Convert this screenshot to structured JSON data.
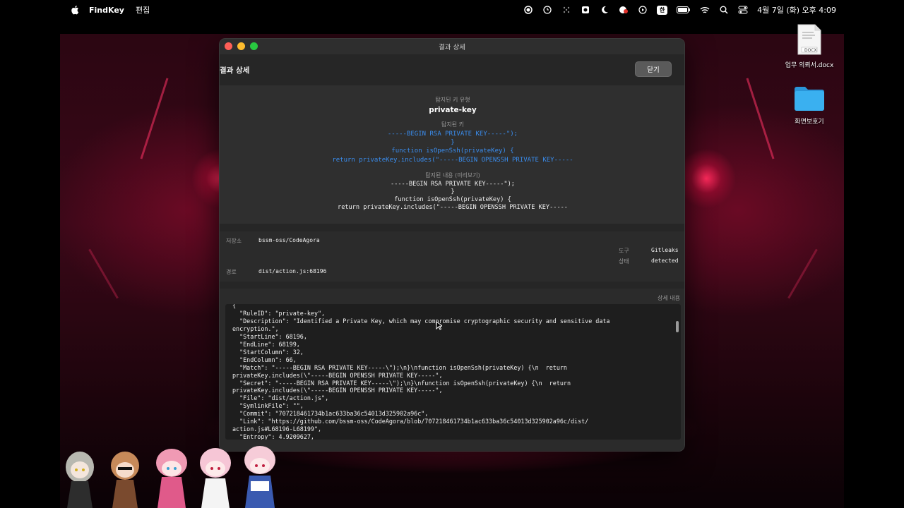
{
  "menubar": {
    "app_name": "FindKey",
    "menu_edit": "편집",
    "datetime": "4월 7일 (화) 오후 4:09",
    "input_source": "한"
  },
  "desktop": {
    "file_name": "업무 의뢰서.docx",
    "file_badge": "DOCX",
    "folder_name": "화면보호기"
  },
  "window": {
    "titlebar": "결과 상세",
    "header_title": "결과 상세",
    "close_label": "닫기",
    "key_type_label": "탐지된 키 유형",
    "key_type": "private-key",
    "detected_key_label": "탐지된 키",
    "detected_key_lines": [
      "-----BEGIN RSA PRIVATE KEY-----\");",
      "}",
      "function isOpenSsh(privateKey) {",
      "return privateKey.includes(\"-----BEGIN OPENSSH PRIVATE KEY-----"
    ],
    "preview_label": "탐지된 내용 (미리보기)",
    "preview_lines": [
      "-----BEGIN RSA PRIVATE KEY-----\");",
      "}",
      "function isOpenSsh(privateKey) {",
      "return privateKey.includes(\"-----BEGIN OPENSSH PRIVATE KEY-----"
    ],
    "meta": {
      "repo_label": "저장소",
      "repo": "bssm-oss/CodeAgora",
      "tool_label": "도구",
      "tool": "Gitleaks",
      "status_label": "상태",
      "status": "detected",
      "path_label": "경로",
      "path": "dist/action.js:68196"
    },
    "details_label": "상세 내용",
    "details_json": "{\n  \"RuleID\": \"private-key\",\n  \"Description\": \"Identified a Private Key, which may compromise cryptographic security and sensitive data\nencryption.\",\n  \"StartLine\": 68196,\n  \"EndLine\": 68199,\n  \"StartColumn\": 32,\n  \"EndColumn\": 66,\n  \"Match\": \"-----BEGIN RSA PRIVATE KEY-----\\\");\\n}\\nfunction isOpenSsh(privateKey) {\\n  return\nprivateKey.includes(\\\"-----BEGIN OPENSSH PRIVATE KEY-----\",\n  \"Secret\": \"-----BEGIN RSA PRIVATE KEY-----\\\");\\n}\\nfunction isOpenSsh(privateKey) {\\n  return\nprivateKey.includes(\\\"-----BEGIN OPENSSH PRIVATE KEY-----\",\n  \"File\": \"dist/action.js\",\n  \"SymlinkFile\": \"\",\n  \"Commit\": \"707218461734b1ac633ba36c54013d325902a96c\",\n  \"Link\": \"https://github.com/bssm-oss/CodeAgora/blob/707218461734b1ac633ba36c54013d325902a96c/dist/\naction.js#L68196-L68199\",\n  \"Entropy\": 4.9209627,"
  },
  "colors": {
    "accent_blue": "#3a8ef0",
    "traffic_red": "#ff5f57",
    "traffic_yellow": "#febc2e",
    "traffic_green": "#28c840",
    "folder_blue": "#3ab0f0"
  }
}
